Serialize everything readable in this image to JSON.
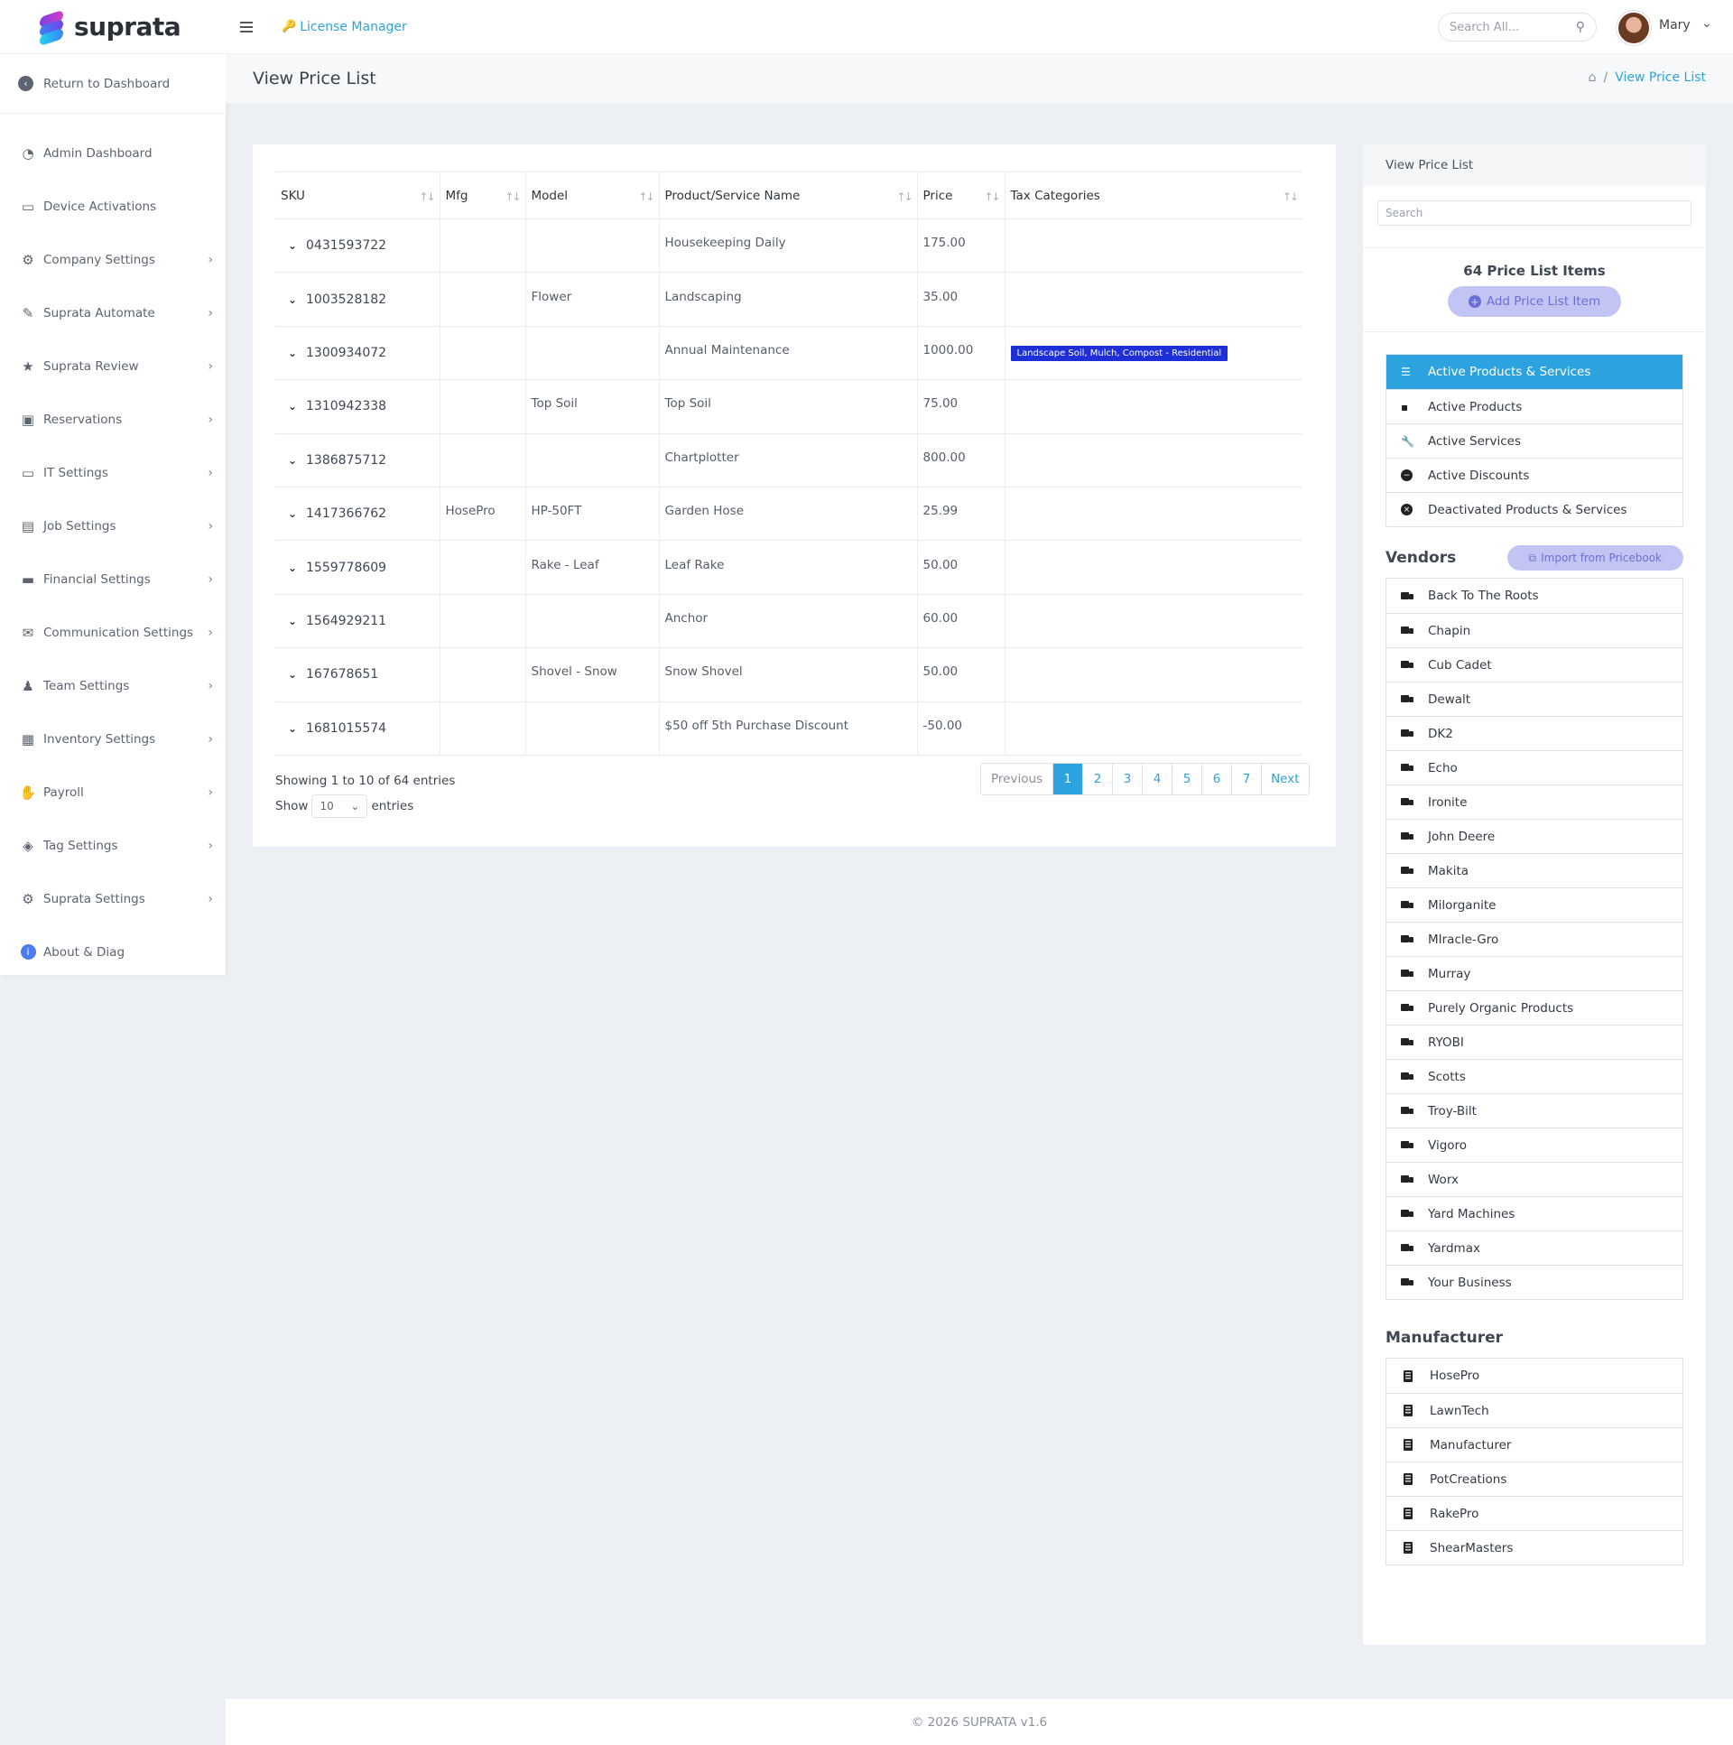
{
  "brand": {
    "name": "suprata"
  },
  "sidebar": {
    "return_label": "Return to Dashboard",
    "items": [
      {
        "label": "Admin Dashboard",
        "icon": "gauge-icon",
        "has_submenu": false
      },
      {
        "label": "Device Activations",
        "icon": "laptop-icon",
        "has_submenu": false
      },
      {
        "label": "Company Settings",
        "icon": "gears-icon",
        "has_submenu": true
      },
      {
        "label": "Suprata Automate",
        "icon": "pen-icon",
        "has_submenu": true
      },
      {
        "label": "Suprata Review",
        "icon": "star-icon",
        "has_submenu": true
      },
      {
        "label": "Reservations",
        "icon": "calendar-check-icon",
        "has_submenu": true
      },
      {
        "label": "IT Settings",
        "icon": "laptop-icon",
        "has_submenu": true
      },
      {
        "label": "Job Settings",
        "icon": "clipboard-icon",
        "has_submenu": true
      },
      {
        "label": "Financial Settings",
        "icon": "money-card-icon",
        "has_submenu": true
      },
      {
        "label": "Communication Settings",
        "icon": "envelope-icon",
        "has_submenu": true
      },
      {
        "label": "Team Settings",
        "icon": "user-gear-icon",
        "has_submenu": true
      },
      {
        "label": "Inventory Settings",
        "icon": "warehouse-icon",
        "has_submenu": true
      },
      {
        "label": "Payroll",
        "icon": "hand-dollar-icon",
        "has_submenu": true
      },
      {
        "label": "Tag Settings",
        "icon": "tags-icon",
        "has_submenu": true
      },
      {
        "label": "Suprata Settings",
        "icon": "gear-icon",
        "has_submenu": true
      },
      {
        "label": "About & Diag",
        "icon": "info-icon",
        "has_submenu": false
      }
    ]
  },
  "topbar": {
    "license_label": "License Manager",
    "search_placeholder": "Search All...",
    "username": "Mary"
  },
  "header": {
    "title": "View Price List",
    "breadcrumb_current": "View Price List",
    "breadcrumb_sep": "/"
  },
  "table": {
    "columns": [
      "SKU",
      "Mfg",
      "Model",
      "Product/Service Name",
      "Price",
      "Tax Categories"
    ],
    "rows": [
      {
        "sku": "0431593722",
        "mfg": "",
        "model": "",
        "name": "Housekeeping Daily",
        "price": "175.00",
        "tax": ""
      },
      {
        "sku": "1003528182",
        "mfg": "",
        "model": "Flower",
        "name": "Landscaping",
        "price": "35.00",
        "tax": ""
      },
      {
        "sku": "1300934072",
        "mfg": "",
        "model": "",
        "name": "Annual Maintenance",
        "price": "1000.00",
        "tax": "Landscape Soil, Mulch, Compost - Residential"
      },
      {
        "sku": "1310942338",
        "mfg": "",
        "model": "Top Soil",
        "name": "Top Soil",
        "price": "75.00",
        "tax": ""
      },
      {
        "sku": "1386875712",
        "mfg": "",
        "model": "",
        "name": "Chartplotter",
        "price": "800.00",
        "tax": ""
      },
      {
        "sku": "1417366762",
        "mfg": "HosePro",
        "model": "HP-50FT",
        "name": "Garden Hose",
        "price": "25.99",
        "tax": ""
      },
      {
        "sku": "1559778609",
        "mfg": "",
        "model": "Rake - Leaf",
        "name": "Leaf Rake",
        "price": "50.00",
        "tax": ""
      },
      {
        "sku": "1564929211",
        "mfg": "",
        "model": "",
        "name": "Anchor",
        "price": "60.00",
        "tax": ""
      },
      {
        "sku": "167678651",
        "mfg": "",
        "model": "Shovel - Snow",
        "name": "Snow Shovel",
        "price": "50.00",
        "tax": ""
      },
      {
        "sku": "1681015574",
        "mfg": "",
        "model": "",
        "name": "$50 off 5th Purchase Discount",
        "price": "-50.00",
        "tax": ""
      }
    ],
    "showing_text": "Showing 1 to 10 of 64 entries",
    "show_label": "Show",
    "page_length": "10",
    "entries_label": "entries",
    "pagination": {
      "previous": "Previous",
      "pages": [
        "1",
        "2",
        "3",
        "4",
        "5",
        "6",
        "7"
      ],
      "active": "1",
      "next": "Next"
    }
  },
  "right_panel": {
    "title": "View Price List",
    "search_placeholder": "Search",
    "count_text": "64 Price List Items",
    "add_button": "Add Price List Item",
    "filters": [
      {
        "label": "Active Products & Services",
        "icon": "list-icon",
        "active": true
      },
      {
        "label": "Active Products",
        "icon": "boxes-icon",
        "active": false
      },
      {
        "label": "Active Services",
        "icon": "wrench-icon",
        "active": false
      },
      {
        "label": "Active Discounts",
        "icon": "minus-circle-icon",
        "active": false
      },
      {
        "label": "Deactivated Products & Services",
        "icon": "x-circle-icon",
        "active": false
      }
    ],
    "vendors_title": "Vendors",
    "import_button": "Import from Pricebook",
    "vendors": [
      "Back To The Roots",
      "Chapin",
      "Cub Cadet",
      "Dewalt",
      "DK2",
      "Echo",
      "Ironite",
      "John Deere",
      "Makita",
      "Milorganite",
      "MIracle-Gro",
      "Murray",
      "Purely Organic Products",
      "RYOBI",
      "Scotts",
      "Troy-Bilt",
      "Vigoro",
      "Worx",
      "Yard Machines",
      "Yardmax",
      "Your Business"
    ],
    "manufacturer_title": "Manufacturer",
    "manufacturers": [
      "HosePro",
      "LawnTech",
      "Manufacturer",
      "PotCreations",
      "RakePro",
      "ShearMasters"
    ]
  },
  "footer": {
    "text": "© 2026 SUPRATA v1.6"
  },
  "colors": {
    "accent": "#2ca3de",
    "badge": "#1f2fd8",
    "button_soft": "#c2c5f3"
  }
}
